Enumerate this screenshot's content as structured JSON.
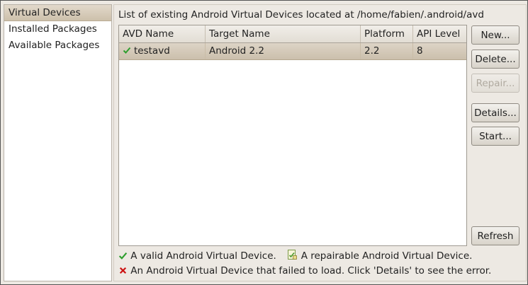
{
  "nav": {
    "items": [
      {
        "label": "Virtual Devices",
        "selected": true
      },
      {
        "label": "Installed Packages",
        "selected": false
      },
      {
        "label": "Available Packages",
        "selected": false
      }
    ]
  },
  "panel": {
    "title": "List of existing Android Virtual Devices located at /home/fabien/.android/avd"
  },
  "table": {
    "columns": [
      "AVD Name",
      "Target Name",
      "Platform",
      "API Level"
    ],
    "rows": [
      {
        "status_icon": "check-icon",
        "avd_name": "testavd",
        "target_name": "Android 2.2",
        "platform": "2.2",
        "api_level": "8"
      }
    ]
  },
  "buttons": {
    "new": "New...",
    "delete": "Delete...",
    "repair": "Repair...",
    "details": "Details...",
    "start": "Start...",
    "refresh": "Refresh"
  },
  "legend": {
    "valid": "A valid Android Virtual Device.",
    "repairable": "A repairable Android Virtual Device.",
    "failed": "An Android Virtual Device that failed to load. Click 'Details' to see the error."
  },
  "colors": {
    "valid_check": "#2e9e2e",
    "failed_x": "#cc1111",
    "selection": "#d6ccbc"
  }
}
